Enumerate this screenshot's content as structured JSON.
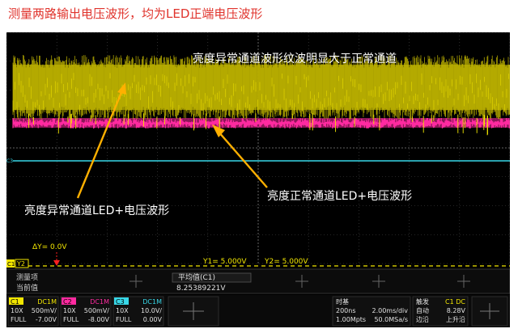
{
  "caption": "测量两路输出电压波形，均为LED正端电压波形",
  "annotations": {
    "top": "亮度异常通道波形纹波明显大于正常通道",
    "left": "亮度异常通道LED+电压波形",
    "right": "亮度正常通道LED+电压波形"
  },
  "markers": {
    "channel3_label": "C3",
    "channel1_label": "C1",
    "delta_y": "ΔY= 0.0V",
    "y1": "Y1= 5.000V",
    "y2": "Y2= 5.000V",
    "cursor_tag": "Y2"
  },
  "measure": {
    "item_label": "测量项",
    "current_label": "当前值",
    "name": "平均值(C1)",
    "value": "8.25389221V"
  },
  "channels": [
    {
      "id": "C1",
      "coupling": "DC1M",
      "probe": "10X",
      "scale": "500mV/",
      "bw": "FULL",
      "offset": "-7.00V",
      "color": "#f2e600"
    },
    {
      "id": "C2",
      "coupling": "DC1M",
      "probe": "10X",
      "scale": "500mV/",
      "bw": "FULL",
      "offset": "-8.00V",
      "color": "#ff2aa0"
    },
    {
      "id": "C3",
      "coupling": "DC1M",
      "probe": "10X",
      "scale": "10.0V/",
      "bw": "FULL",
      "offset": "0.00V",
      "color": "#38d8e8"
    }
  ],
  "timebase": {
    "title": "时基",
    "delay": "200ns",
    "scale": "2.00ms/div",
    "points": "1.00Mpts",
    "rate": "50.0MSa/s"
  },
  "trigger": {
    "title": "触发",
    "source": "C1 DC",
    "mode": "自动",
    "level": "8.28V",
    "type": "边沿",
    "slope": "上升沿"
  },
  "colors": {
    "accent_red": "#e0332c",
    "annotation_arrow": "#ffb000",
    "grid": "#4a4a4a",
    "ch1": "#f2e600",
    "ch2": "#ff2aa0",
    "ch3": "#38d8e8"
  }
}
